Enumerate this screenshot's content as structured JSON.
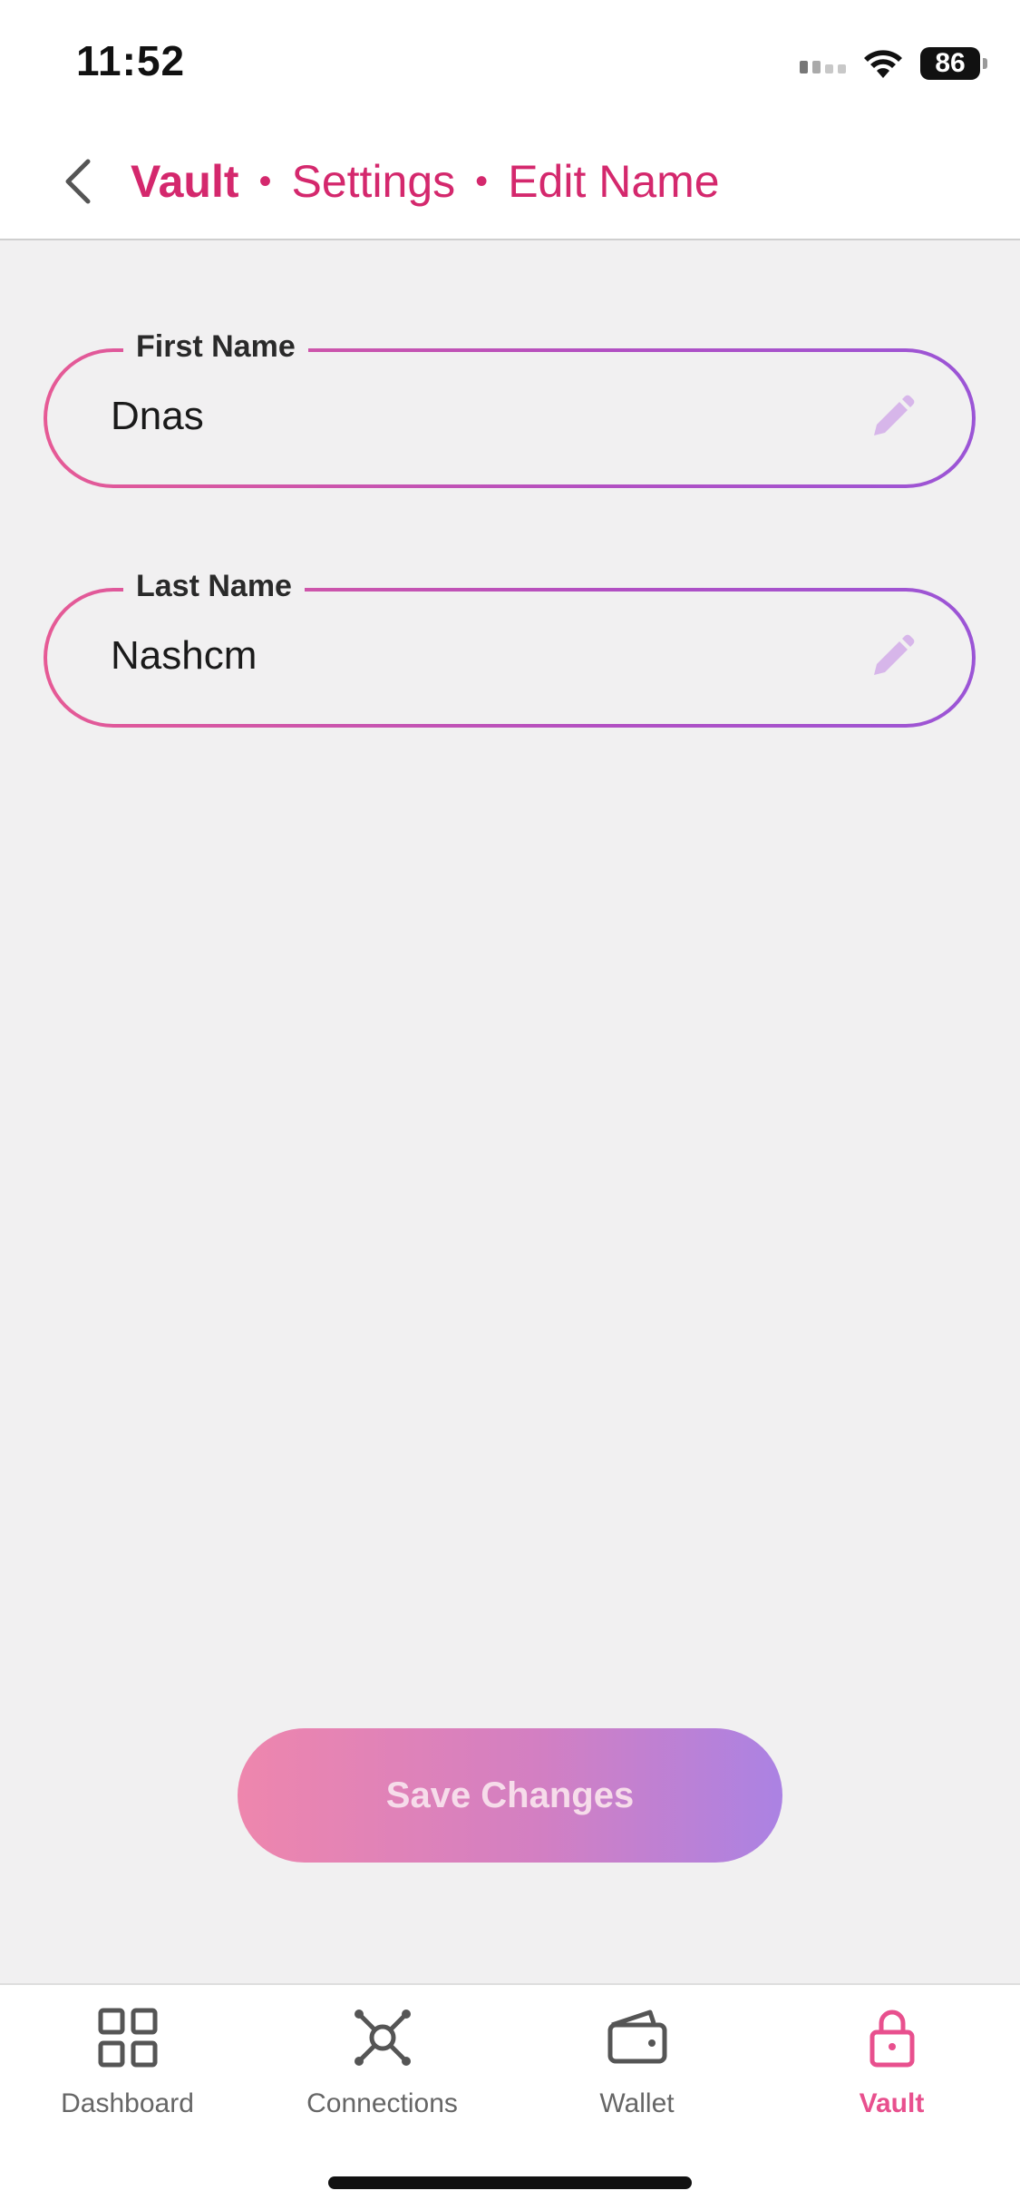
{
  "status_bar": {
    "time": "11:52",
    "battery": "86",
    "icons": [
      "signal-icon",
      "wifi-icon",
      "battery-icon"
    ]
  },
  "header": {
    "breadcrumb": [
      "Vault",
      "Settings",
      "Edit Name"
    ],
    "separator": "•",
    "accent_color": "#d4286d"
  },
  "form": {
    "first_name": {
      "label": "First Name",
      "value": "Dnas"
    },
    "last_name": {
      "label": "Last Name",
      "value": "Nashcm"
    }
  },
  "actions": {
    "save_label": "Save Changes"
  },
  "tab_bar": {
    "tabs": [
      {
        "label": "Dashboard",
        "icon": "grid-icon",
        "active": false
      },
      {
        "label": "Connections",
        "icon": "connections-icon",
        "active": false
      },
      {
        "label": "Wallet",
        "icon": "wallet-icon",
        "active": false
      },
      {
        "label": "Vault",
        "icon": "lock-icon",
        "active": true
      }
    ],
    "active_color": "#e8508e",
    "inactive_color": "#555555"
  }
}
